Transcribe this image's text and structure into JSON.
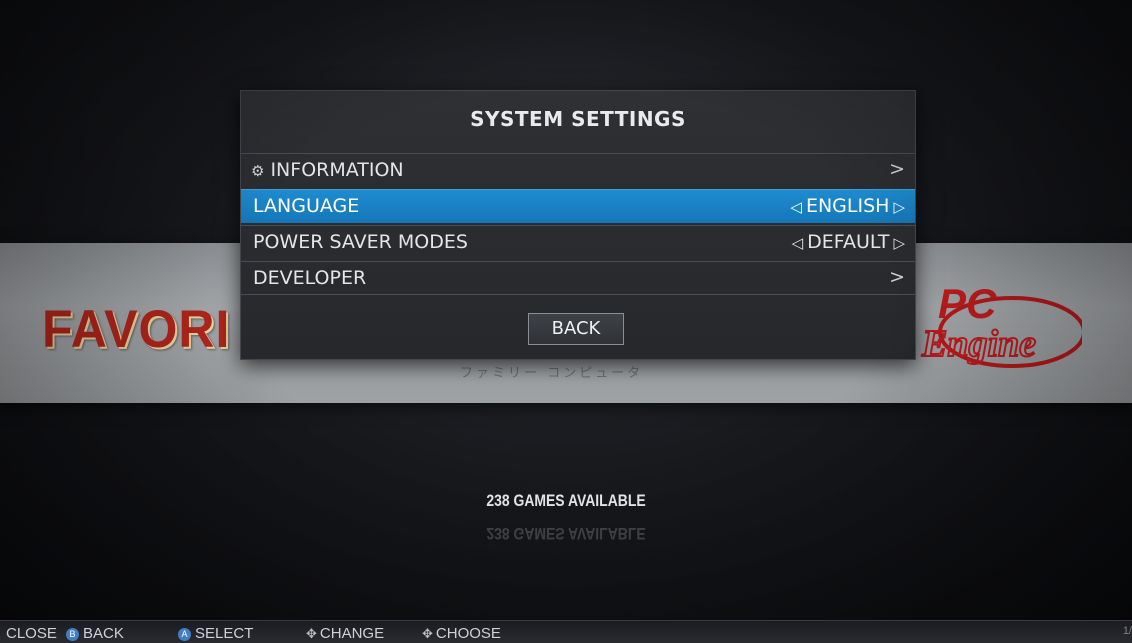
{
  "dialog": {
    "title": "SYSTEM SETTINGS",
    "items": [
      {
        "label": "INFORMATION",
        "icon": "gear-icon",
        "value": "",
        "kind": "submenu"
      },
      {
        "label": "LANGUAGE",
        "value": "ENGLISH",
        "kind": "selector",
        "selected": true
      },
      {
        "label": "POWER SAVER MODES",
        "value": "DEFAULT",
        "kind": "selector"
      },
      {
        "label": "DEVELOPER",
        "value": "",
        "kind": "submenu"
      }
    ],
    "back_label": "BACK"
  },
  "carousel": {
    "left_logo": "FAVORITES",
    "right_logo": "PC Engine",
    "jp_subtitle": "ファミリー コンピュータ"
  },
  "status": {
    "games_available": "238 GAMES AVAILABLE"
  },
  "footer": {
    "close": "CLOSE",
    "back": "BACK",
    "select": "SELECT",
    "change": "CHANGE",
    "choose": "CHOOSE",
    "page": "1/"
  },
  "colors": {
    "selection": "#1a82c4",
    "dialog_bg": "#2b2d31",
    "favorites_red": "#b3261c"
  }
}
